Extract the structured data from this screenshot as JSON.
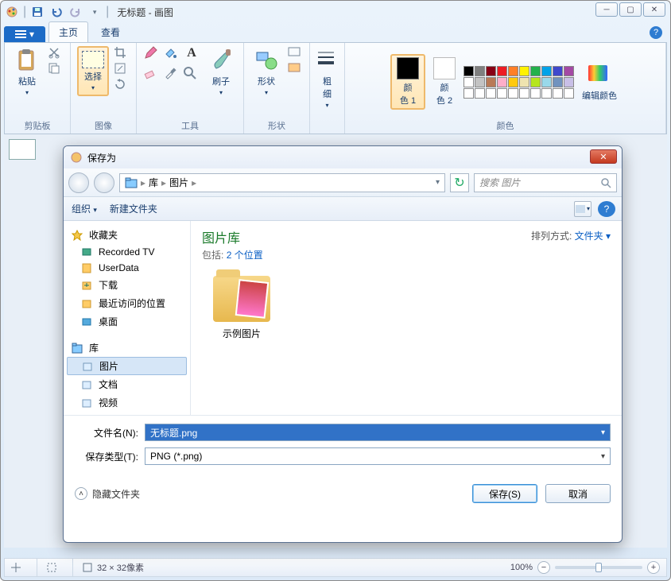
{
  "title": "无标题 - 画图",
  "tabs": {
    "file": "▾",
    "home": "主页",
    "view": "查看"
  },
  "ribbon": {
    "clipboard": {
      "label": "剪贴板",
      "paste": "粘贴"
    },
    "image": {
      "label": "图像",
      "select": "选择"
    },
    "tools": {
      "label": "工具"
    },
    "shapes": {
      "label": "形状",
      "btn": "形状"
    },
    "thickness": {
      "label": "粗\n细"
    },
    "colors": {
      "label": "颜色",
      "c1": "颜\n色 1",
      "c2": "颜\n色 2",
      "edit": "编辑颜色",
      "c1_value": "#000000",
      "c2_value": "#ffffff",
      "palette": [
        "#000000",
        "#7f7f7f",
        "#880015",
        "#ed1c24",
        "#ff7f27",
        "#fff200",
        "#22b14c",
        "#00a2e8",
        "#3f48cc",
        "#a349a4",
        "#ffffff",
        "#c3c3c3",
        "#b97a57",
        "#ffaec9",
        "#ffc90e",
        "#efe4b0",
        "#b5e61d",
        "#99d9ea",
        "#7092be",
        "#c8bfe7",
        "#ffffff",
        "#ffffff",
        "#ffffff",
        "#ffffff",
        "#ffffff",
        "#ffffff",
        "#ffffff",
        "#ffffff",
        "#ffffff",
        "#ffffff"
      ]
    }
  },
  "dialog": {
    "title": "保存为",
    "path": {
      "root": "库",
      "folder": "图片"
    },
    "search_placeholder": "搜索 图片",
    "toolbar": {
      "organize": "组织",
      "newfolder": "新建文件夹"
    },
    "tree": {
      "favorites": "收藏夹",
      "items_fav": [
        "Recorded TV",
        "UserData",
        "下载",
        "最近访问的位置",
        "桌面"
      ],
      "libraries": "库",
      "items_lib": [
        "图片",
        "文档",
        "视频"
      ]
    },
    "content": {
      "title": "图片库",
      "includes_label": "包括:",
      "includes_link": "2 个位置",
      "arrange_label": "排列方式:",
      "arrange_link": "文件夹",
      "sample": "示例图片"
    },
    "fields": {
      "filename_label": "文件名(N):",
      "filename_value": "无标题.png",
      "type_label": "保存类型(T):",
      "type_value": "PNG (*.png)"
    },
    "footer": {
      "hide": "隐藏文件夹",
      "save": "保存(S)",
      "cancel": "取消"
    }
  },
  "status": {
    "dims": "32 × 32像素",
    "zoom": "100%"
  }
}
